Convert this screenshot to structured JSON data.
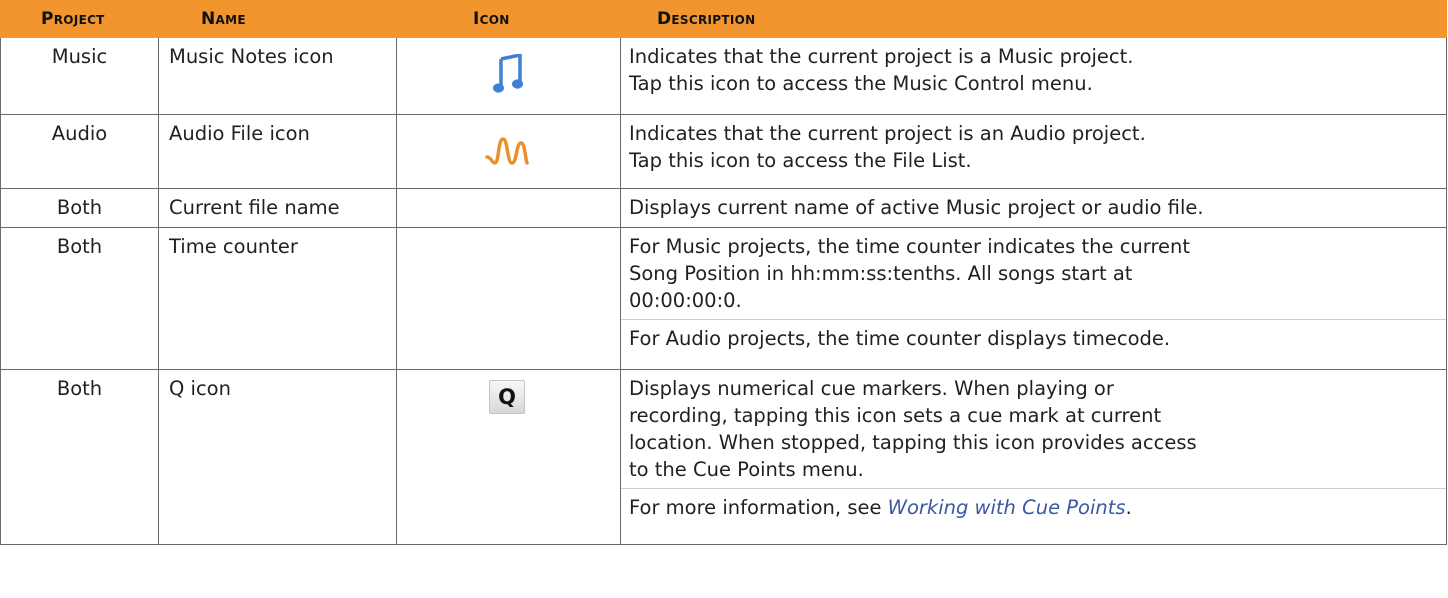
{
  "table": {
    "headers": {
      "project": "Project",
      "name": "Name",
      "icon": "Icon",
      "description": "Description"
    },
    "rows": [
      {
        "project": "Music",
        "name": "Music Notes icon",
        "icon": "music-notes-icon",
        "description": [
          "Indicates that the current project is a Music project.",
          "Tap this icon to access the Music Control menu."
        ]
      },
      {
        "project": "Audio",
        "name": "Audio File icon",
        "icon": "audio-wave-icon",
        "description": [
          "Indicates that the current project is an Audio project.",
          "Tap this icon to access the File List."
        ]
      },
      {
        "project": "Both",
        "name": "Current file name",
        "icon": "",
        "description": [
          "Displays current name of active Music project or audio file."
        ]
      },
      {
        "project": "Both",
        "name": "Time counter",
        "icon": "",
        "description": [
          "For Music projects, the time counter indicates the current",
          "Song Position in hh:mm:ss:tenths. All songs start at",
          "00:00:00:0."
        ],
        "description_2": "For Audio projects, the time counter displays timecode."
      },
      {
        "project": "Both",
        "name": "Q icon",
        "icon": "q-icon",
        "icon_label": "Q",
        "description": [
          "Displays numerical cue markers. When playing or",
          "recording, tapping this icon sets a cue mark at current",
          "location. When stopped, tapping this icon provides access",
          "to the Cue Points menu."
        ],
        "description_2_prefix": "For more information, see ",
        "description_2_link": "Working with Cue Points",
        "description_2_suffix": "."
      }
    ]
  },
  "colors": {
    "header_bg": "#f2952e",
    "music_icon": "#3f7fd6",
    "audio_icon": "#e8912a",
    "link": "#3b58a4",
    "border": "#6a6a6a"
  }
}
